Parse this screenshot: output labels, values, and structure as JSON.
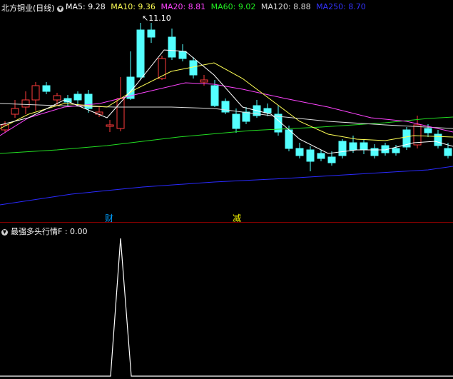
{
  "header": {
    "title": "北方铜业(日线)",
    "ma": [
      {
        "label": "MA5: 9.28",
        "color": "#ffffff"
      },
      {
        "label": "MA10: 9.36",
        "color": "#ffff55"
      },
      {
        "label": "MA20: 8.81",
        "color": "#ff44ff"
      },
      {
        "label": "MA60: 9.02",
        "color": "#22ee22"
      },
      {
        "label": "MA120: 8.88",
        "color": "#dddddd"
      },
      {
        "label": "MA250: 8.70",
        "color": "#3333ff"
      }
    ]
  },
  "chart": {
    "high_label": "11.10",
    "markers": [
      {
        "text": "财",
        "color": "#00a0ff"
      },
      {
        "text": "减",
        "color": "#ffff00"
      }
    ]
  },
  "indicator": {
    "label": "最强多头行情F : 0.00"
  },
  "colors": {
    "up": "#ff3b3b",
    "down": "#54ffff",
    "bg": "#000000"
  }
}
